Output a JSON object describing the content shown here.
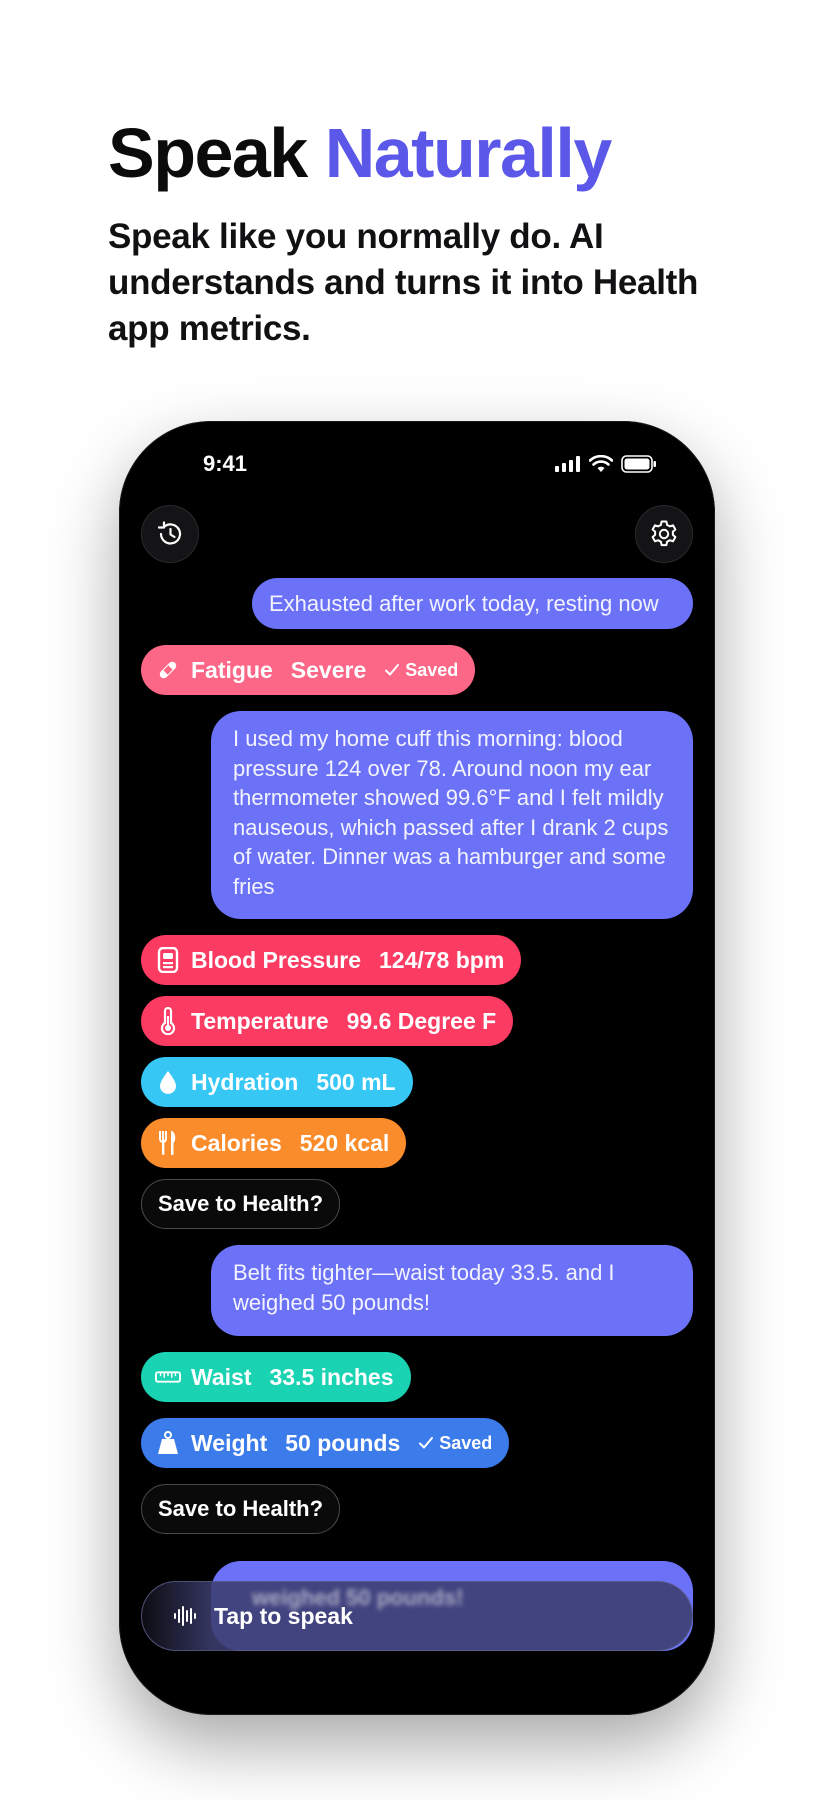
{
  "headline": {
    "word1": "Speak",
    "word2": "Naturally"
  },
  "subhead": "Speak like you normally do. AI understands and turns it into Health app metrics.",
  "status_bar": {
    "time": "9:41"
  },
  "messages": {
    "m1": "Exhausted after work today, resting now",
    "m2": "I used my home cuff this morning: blood pressure 124 over 78. Around noon my ear thermometer showed 99.6°F and I felt mildly nauseous, which passed after I drank 2 cups of water. Dinner was a hamburger and some fries",
    "m3": "Belt fits tighter—waist today 33.5. and I weighed 50 pounds!"
  },
  "metrics": {
    "fatigue": {
      "label": "Fatigue",
      "value": "Severe",
      "status": "Saved",
      "icon": "bandage-icon"
    },
    "bp": {
      "label": "Blood Pressure",
      "value": "124/78 bpm",
      "icon": "cuff-monitor-icon"
    },
    "temp": {
      "label": "Temperature",
      "value": "99.6 Degree F",
      "icon": "thermometer-icon"
    },
    "hyd": {
      "label": "Hydration",
      "value": "500 mL",
      "icon": "drop-icon"
    },
    "cal": {
      "label": "Calories",
      "value": "520 kcal",
      "icon": "fork-knife-icon"
    },
    "waist": {
      "label": "Waist",
      "value": "33.5 inches",
      "icon": "tape-measure-icon"
    },
    "weight": {
      "label": "Weight",
      "value": "50 pounds",
      "status": "Saved",
      "icon": "scale-weight-icon"
    }
  },
  "save_prompt": "Save to Health?",
  "input": {
    "tap_label": "Tap to speak",
    "ghost_text": "weighed 50 pounds!"
  },
  "colors": {
    "accent": "#5b57e8",
    "bubble": "#6b72f7",
    "fatigue": "#fc6787",
    "blood_pressure": "#fb3b62",
    "hydration": "#36c7f5",
    "calories": "#fb8c2c",
    "waist": "#19d3b3",
    "weight": "#3c7bea"
  }
}
